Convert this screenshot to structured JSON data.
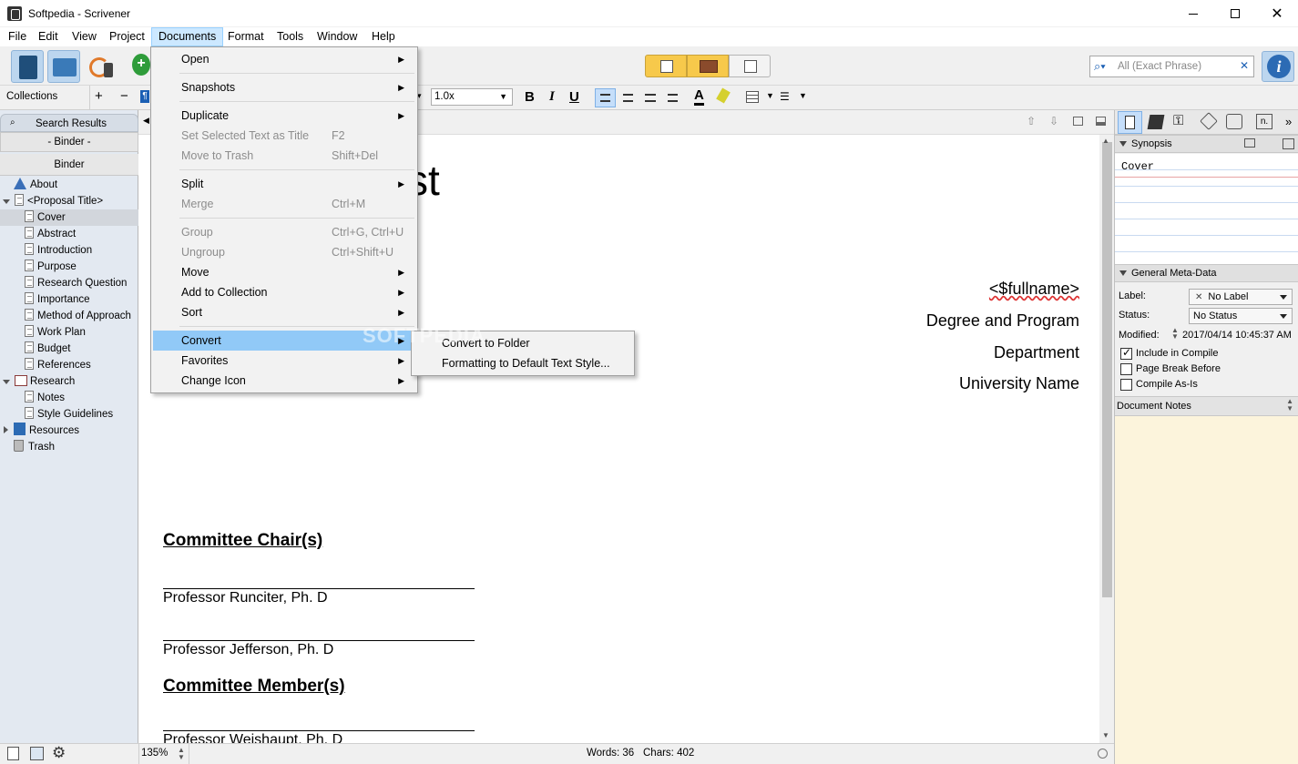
{
  "window": {
    "title": "Softpedia - Scrivener"
  },
  "menubar": [
    "File",
    "Edit",
    "View",
    "Project",
    "Documents",
    "Format",
    "Tools",
    "Window",
    "Help"
  ],
  "toolbar": {
    "search_placeholder": "All (Exact Phrase)"
  },
  "format_bar": {
    "line_spacing": "1.0x",
    "bold": "B",
    "italic": "I",
    "underline": "U"
  },
  "left_pane": {
    "collections_label": "Collections",
    "plus": "+",
    "minus": "−",
    "search_results": "Search Results",
    "binder_dash": "- Binder -",
    "binder_tab": "Binder",
    "items": [
      {
        "label": "About",
        "indent": 0
      },
      {
        "label": "<Proposal Title>",
        "indent": 0
      },
      {
        "label": "Cover",
        "indent": 1,
        "selected": true
      },
      {
        "label": "Abstract",
        "indent": 1
      },
      {
        "label": "Introduction",
        "indent": 1
      },
      {
        "label": "Purpose",
        "indent": 1
      },
      {
        "label": "Research Question",
        "indent": 1
      },
      {
        "label": "Importance",
        "indent": 1
      },
      {
        "label": "Method of Approach",
        "indent": 1
      },
      {
        "label": "Work Plan",
        "indent": 1
      },
      {
        "label": "Budget",
        "indent": 1
      },
      {
        "label": "References",
        "indent": 1
      },
      {
        "label": "Research",
        "indent": 0
      },
      {
        "label": "Notes",
        "indent": 1
      },
      {
        "label": "Style Guidelines",
        "indent": 1
      },
      {
        "label": "Resources",
        "indent": 0
      },
      {
        "label": "Trash",
        "indent": 0
      }
    ]
  },
  "documents_menu": {
    "items": [
      {
        "label": "Open",
        "shortcut": "",
        "submenu": true,
        "disabled": false
      },
      {
        "label": "Snapshots",
        "shortcut": "",
        "submenu": true,
        "disabled": false
      },
      {
        "label": "Duplicate",
        "shortcut": "",
        "submenu": true,
        "disabled": false
      },
      {
        "label": "Set Selected Text as Title",
        "shortcut": "F2",
        "submenu": false,
        "disabled": true
      },
      {
        "label": "Move to Trash",
        "shortcut": "Shift+Del",
        "submenu": false,
        "disabled": true
      },
      {
        "label": "Split",
        "shortcut": "",
        "submenu": true,
        "disabled": false
      },
      {
        "label": "Merge",
        "shortcut": "Ctrl+M",
        "submenu": false,
        "disabled": true
      },
      {
        "label": "Group",
        "shortcut": "Ctrl+G, Ctrl+U",
        "submenu": false,
        "disabled": true
      },
      {
        "label": "Ungroup",
        "shortcut": "Ctrl+Shift+U",
        "submenu": false,
        "disabled": true
      },
      {
        "label": "Move",
        "shortcut": "",
        "submenu": true,
        "disabled": false
      },
      {
        "label": "Add to Collection",
        "shortcut": "",
        "submenu": true,
        "disabled": false
      },
      {
        "label": "Sort",
        "shortcut": "",
        "submenu": true,
        "disabled": false
      },
      {
        "label": "Convert",
        "shortcut": "",
        "submenu": true,
        "disabled": false,
        "highlighted": true
      },
      {
        "label": "Favorites",
        "shortcut": "",
        "submenu": true,
        "disabled": false
      },
      {
        "label": "Change Icon",
        "shortcut": "",
        "submenu": true,
        "disabled": false
      }
    ],
    "convert_submenu": [
      "Convert to Folder",
      "Formatting to Default Text Style..."
    ]
  },
  "document": {
    "title_fragment": "st",
    "fullname": "<$fullname>",
    "degree": "Degree and Program",
    "department": "Department",
    "university": "University Name",
    "chair_heading": "Committee Chair(s)",
    "chair1": "Professor Runciter, Ph. D",
    "chair2": "Professor Jefferson, Ph. D",
    "member_heading": "Committee Member(s)",
    "member1": "Professor Weishaupt, Ph. D"
  },
  "inspector": {
    "synopsis_label": "Synopsis",
    "synopsis_text": "Cover",
    "meta_label": "General Meta-Data",
    "label_label": "Label:",
    "label_value": "No Label",
    "status_label": "Status:",
    "status_value": "No Status",
    "modified_label": "Modified:",
    "modified_value": "2017/04/14 10:45:37 AM",
    "include_compile": "Include in Compile",
    "page_break": "Page Break Before",
    "compile_as_is": "Compile As-Is",
    "doc_notes": "Document Notes"
  },
  "status": {
    "zoom": "135%",
    "words": "Words: 36",
    "chars": "Chars: 402"
  },
  "watermark": "SOFTPEDIA",
  "colors": {
    "accent": "#91c9f7",
    "notes_bg": "#fcf4dc",
    "binder_bg": "#e3e9f1"
  }
}
